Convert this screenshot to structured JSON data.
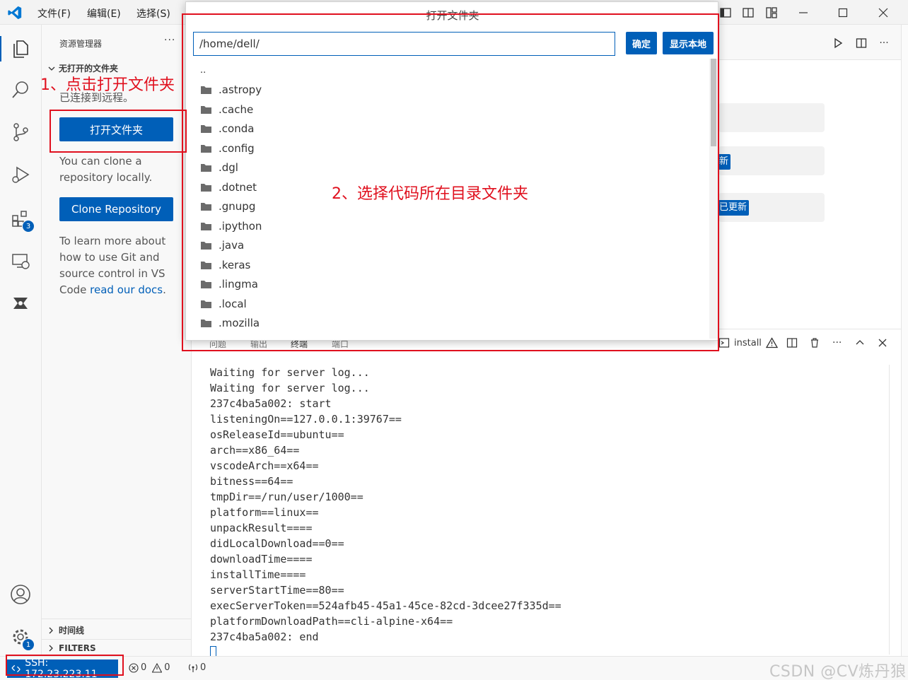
{
  "titlebar": {
    "menus": [
      "文件(F)",
      "编辑(E)",
      "选择(S)"
    ]
  },
  "activitybar": {
    "extensions_badge": "3",
    "settings_badge": "1"
  },
  "sidebar": {
    "title": "资源管理器",
    "more": "···",
    "section": "无打开的文件夹",
    "connected_text": "已连接到远程。",
    "open_folder_label": "打开文件夹",
    "clone_text": "You can clone a repository locally.",
    "clone_button": "Clone Repository",
    "learn_text": "To learn more about how to use Git and source control in VS Code ",
    "learn_link": "read our docs",
    "learn_end": ".",
    "timeline": "时间线",
    "filters": "FILTERS"
  },
  "editor": {
    "badge1": "新",
    "badge2": "已更新"
  },
  "panel": {
    "tabs": [
      "问题",
      "输出",
      "终端",
      "端口"
    ],
    "install_label": "install",
    "terminal_lines": [
      "Waiting for server log...",
      "Waiting for server log...",
      "237c4ba5a002: start",
      "listeningOn==127.0.0.1:39767==",
      "osReleaseId==ubuntu==",
      "arch==x86_64==",
      "vscodeArch==x64==",
      "bitness==64==",
      "tmpDir==/run/user/1000==",
      "platform==linux==",
      "unpackResult====",
      "didLocalDownload==0==",
      "downloadTime====",
      "installTime====",
      "serverStartTime==80==",
      "execServerToken==524afb45-45a1-45ce-82cd-3dcee27f335d==",
      "platformDownloadPath==cli-alpine-x64==",
      "237c4ba5a002: end"
    ]
  },
  "statusbar": {
    "ssh": "SSH: 172.23.223.11",
    "errors": "0",
    "warnings": "0",
    "ports": "0",
    "watermark": "CSDN @CV炼丹狼"
  },
  "dialog": {
    "title": "打开文件夹",
    "path_value": "/home/dell/",
    "confirm_label": "确定",
    "show_local_label": "显示本地",
    "parent_entry": "..",
    "folders": [
      ".astropy",
      ".cache",
      ".conda",
      ".config",
      ".dgl",
      ".dotnet",
      ".gnupg",
      ".ipython",
      ".java",
      ".keras",
      ".lingma",
      ".local",
      ".mozilla"
    ]
  },
  "annotations": {
    "step1": "1、点击打开文件夹",
    "step2": "2、选择代码所在目录文件夹"
  },
  "colors": {
    "accent": "#005fb8",
    "annotation_red": "#e0101e"
  }
}
